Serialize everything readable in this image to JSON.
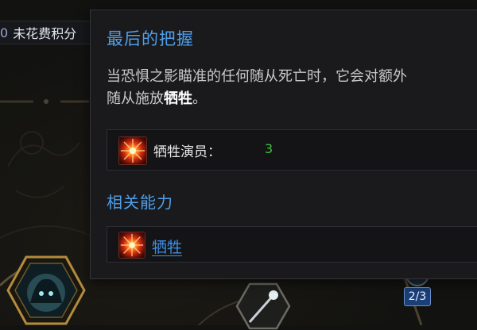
{
  "header": {
    "points_number": "0",
    "points_label": "未花费积分"
  },
  "tooltip": {
    "title": "最后的把握",
    "description_line1": "当恐惧之影瞄准的任何随从死亡时，它会对额外",
    "description_line2_prefix": "随从施放",
    "description_keyword": "牺牲",
    "description_line2_suffix": "。",
    "stat": {
      "label": "牺牲演员：",
      "value": "3",
      "icon": "sacrifice-burst-icon"
    },
    "related_title": "相关能力",
    "related": [
      {
        "label": "牺牲",
        "icon": "sacrifice-burst-icon"
      }
    ]
  },
  "skill_tree": {
    "rank_badge": "2/3"
  },
  "colors": {
    "title_blue": "#4f9fe8",
    "link_blue": "#3e8ee6",
    "stat_green": "#3fbf3f",
    "badge_bg": "#1b3f77"
  }
}
